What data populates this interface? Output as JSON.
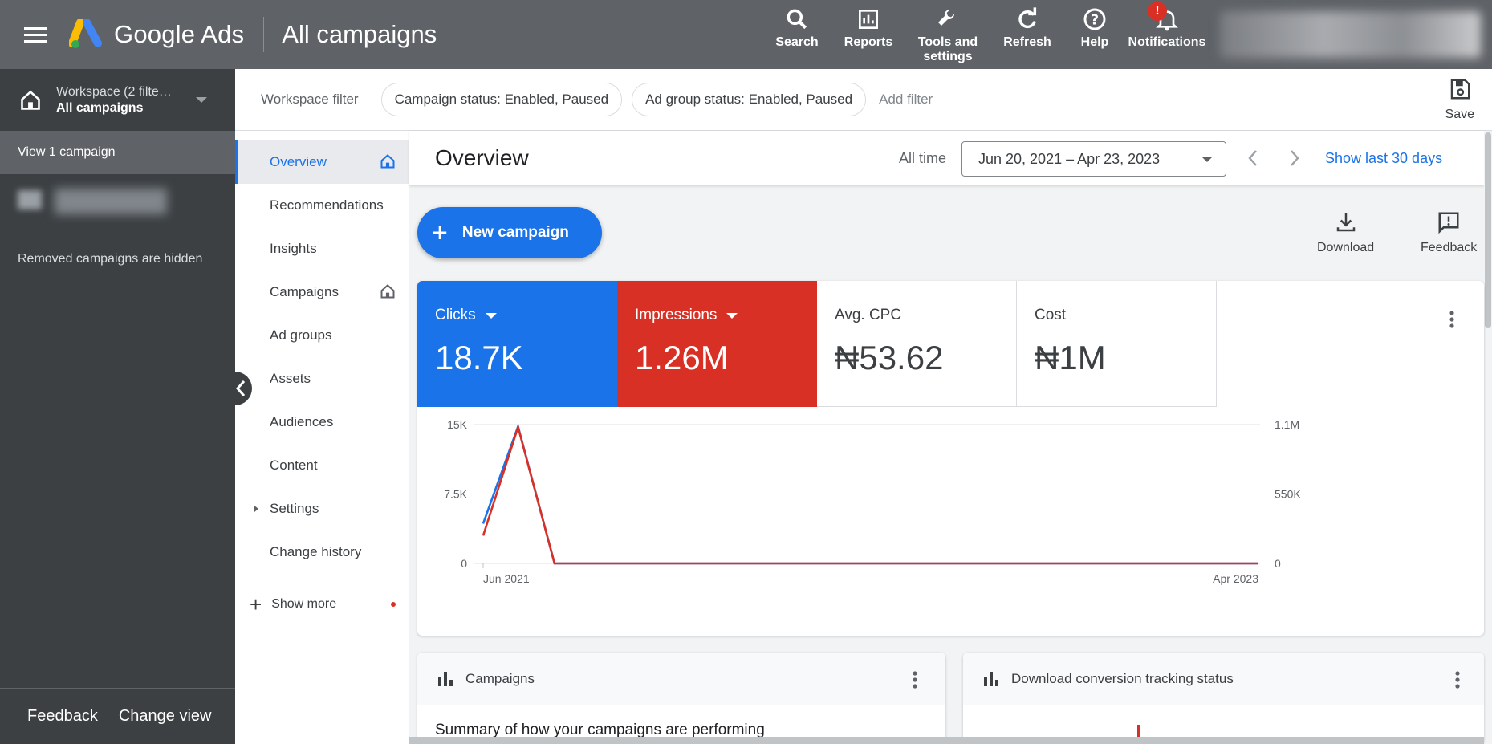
{
  "topbar": {
    "brand": "Google Ads",
    "page_title": "All campaigns",
    "actions": [
      {
        "label": "Search",
        "icon": "search-icon"
      },
      {
        "label": "Reports",
        "icon": "reports-icon"
      },
      {
        "label": "Tools and settings",
        "icon": "wrench-icon"
      },
      {
        "label": "Refresh",
        "icon": "refresh-icon"
      },
      {
        "label": "Help",
        "icon": "help-icon"
      },
      {
        "label": "Notifications",
        "icon": "bell-icon"
      }
    ],
    "notification_badge": "!"
  },
  "leftnav": {
    "workspace_sub": "Workspace (2 filte…",
    "workspace_main": "All campaigns",
    "view_campaign": "View 1 campaign",
    "removed_note": "Removed campaigns are hidden",
    "footer_feedback": "Feedback",
    "footer_change_view": "Change view"
  },
  "filterbar": {
    "label": "Workspace filter",
    "chips": [
      "Campaign status: Enabled, Paused",
      "Ad group status: Enabled, Paused"
    ],
    "add_filter": "Add filter",
    "save": "Save"
  },
  "pagenav": {
    "items": [
      "Overview",
      "Recommendations",
      "Insights",
      "Campaigns",
      "Ad groups",
      "Assets",
      "Audiences",
      "Content",
      "Settings",
      "Change history"
    ],
    "show_more": "Show more"
  },
  "overview": {
    "title": "Overview",
    "range_label": "All time",
    "date_range": "Jun 20, 2021 – Apr 23, 2023",
    "show_last": "Show last 30 days",
    "new_campaign": "New campaign",
    "download": "Download",
    "feedback": "Feedback"
  },
  "metrics": [
    {
      "label": "Clicks",
      "value": "18.7K",
      "color": "#1a73e8"
    },
    {
      "label": "Impressions",
      "value": "1.26M",
      "color": "#d93025"
    },
    {
      "label": "Avg. CPC",
      "value": "₦53.62"
    },
    {
      "label": "Cost",
      "value": "₦1M"
    }
  ],
  "chart_data": {
    "type": "line",
    "x_tick_labels": [
      "Jun 2021",
      "Apr 2023"
    ],
    "left_axis_ticks": [
      "15K",
      "7.5K",
      "0"
    ],
    "right_axis_ticks": [
      "1.1M",
      "550K",
      "0"
    ],
    "ylim_left": [
      0,
      15000
    ],
    "ylim_right": [
      0,
      1100000
    ],
    "grid": true,
    "series": [
      {
        "name": "Clicks",
        "color": "#1a73e8",
        "axis": "left",
        "points": [
          [
            0,
            4300
          ],
          [
            0.045,
            14800
          ],
          [
            0.092,
            0
          ],
          [
            1,
            0
          ]
        ]
      },
      {
        "name": "Impressions",
        "color": "#d93025",
        "axis": "right",
        "points": [
          [
            0,
            220000
          ],
          [
            0.045,
            1080000
          ],
          [
            0.092,
            0
          ],
          [
            1,
            0
          ]
        ]
      }
    ]
  },
  "cards": [
    {
      "title": "Campaigns",
      "body": "Summary of how your campaigns are performing"
    },
    {
      "title": "Download conversion tracking status",
      "body": ""
    }
  ]
}
